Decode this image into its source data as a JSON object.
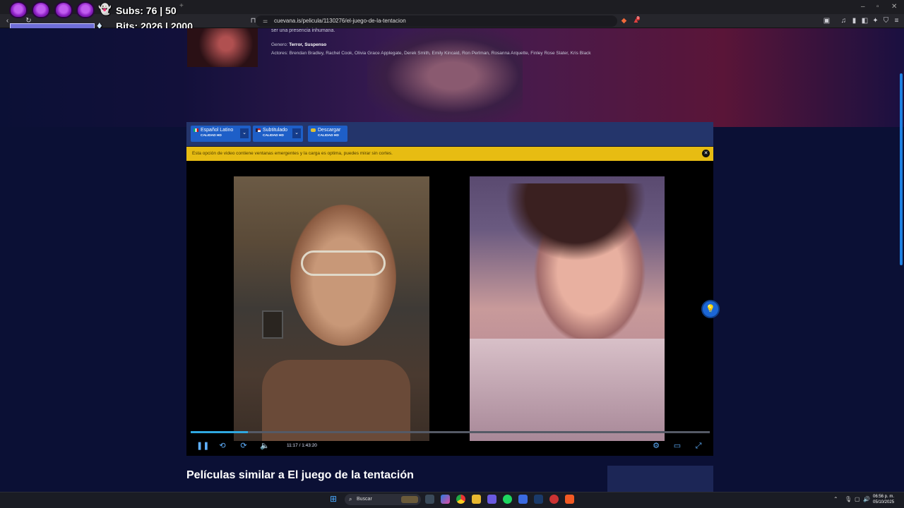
{
  "browser": {
    "url": "cuevana.is/pelicula/1130276/el-juego-de-la-tentacion",
    "tab_title": "",
    "shield_badge": "9"
  },
  "overlay": {
    "subs_label": "Subs: 76 | 50",
    "bits_label": "Bits: 2026 | 2000",
    "hearts": 4,
    "bits_progress": 1.0
  },
  "movie": {
    "synopsis_tail": "ser una presencia inhumana.",
    "genre_label": "Genero: ",
    "genres": "Terror, Suspenso",
    "actors": "Actores: Brendan Bradley, Rachel Cook, Olivia Grace Applegate, Derek Smith, Emily Kincaid, Ron Perlman, Rosanna Arquette, Finley Rose Slater, Kris Black"
  },
  "player": {
    "options": [
      {
        "label": "Español Latino",
        "quality": "CALIDAD HD"
      },
      {
        "label": "Subtitulado",
        "quality": "CALIDAD HD"
      },
      {
        "label": "Descargar",
        "quality": "CALIDAD HD"
      }
    ],
    "warning": "Esta opción de video contiene ventanas emergentes y la carga es optima, puedes mirar sin cortes.",
    "current_time": "11:17",
    "separator": "/",
    "duration": "1:43:20",
    "progress_fraction": 0.11
  },
  "page": {
    "similar_heading": "Películas similar a El juego de la tentación"
  },
  "taskbar": {
    "search_placeholder": "Buscar",
    "time": "06:56 p. m.",
    "date": "05/10/2025"
  },
  "colors": {
    "accent": "#1e5fc8",
    "warning": "#e7bc12",
    "progress": "#2fa8e0"
  }
}
